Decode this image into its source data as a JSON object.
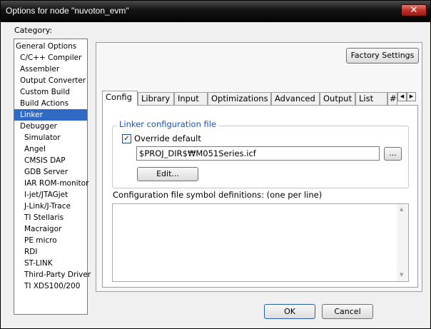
{
  "window": {
    "title": "Options for node \"nuvoton_evm\"",
    "close_symbol": "✕"
  },
  "category": {
    "label": "Category:",
    "items": [
      {
        "label": "General Options",
        "level": 0,
        "selected": false
      },
      {
        "label": "C/C++ Compiler",
        "level": 1,
        "selected": false
      },
      {
        "label": "Assembler",
        "level": 1,
        "selected": false
      },
      {
        "label": "Output Converter",
        "level": 1,
        "selected": false
      },
      {
        "label": "Custom Build",
        "level": 1,
        "selected": false
      },
      {
        "label": "Build Actions",
        "level": 1,
        "selected": false
      },
      {
        "label": "Linker",
        "level": 1,
        "selected": true
      },
      {
        "label": "Debugger",
        "level": 1,
        "selected": false
      },
      {
        "label": "Simulator",
        "level": 2,
        "selected": false
      },
      {
        "label": "Angel",
        "level": 2,
        "selected": false
      },
      {
        "label": "CMSIS DAP",
        "level": 2,
        "selected": false
      },
      {
        "label": "GDB Server",
        "level": 2,
        "selected": false
      },
      {
        "label": "IAR ROM-monitor",
        "level": 2,
        "selected": false
      },
      {
        "label": "I-jet/JTAGjet",
        "level": 2,
        "selected": false
      },
      {
        "label": "J-Link/J-Trace",
        "level": 2,
        "selected": false
      },
      {
        "label": "TI Stellaris",
        "level": 2,
        "selected": false
      },
      {
        "label": "Macraigor",
        "level": 2,
        "selected": false
      },
      {
        "label": "PE micro",
        "level": 2,
        "selected": false
      },
      {
        "label": "RDI",
        "level": 2,
        "selected": false
      },
      {
        "label": "ST-LINK",
        "level": 2,
        "selected": false
      },
      {
        "label": "Third-Party Driver",
        "level": 2,
        "selected": false
      },
      {
        "label": "TI XDS100/200",
        "level": 2,
        "selected": false
      }
    ]
  },
  "factory_settings_label": "Factory Settings",
  "tabs": [
    {
      "label": "Config",
      "active": true
    },
    {
      "label": "Library",
      "active": false
    },
    {
      "label": "Input",
      "active": false
    },
    {
      "label": "Optimizations",
      "active": false
    },
    {
      "label": "Advanced",
      "active": false
    },
    {
      "label": "Output",
      "active": false
    },
    {
      "label": "List",
      "active": false
    },
    {
      "label": "#",
      "active": false
    }
  ],
  "tab_scroll": {
    "left_symbol": "◀",
    "right_symbol": "▶"
  },
  "linker_config": {
    "group_title": "Linker configuration file",
    "override_label": "Override default",
    "override_checked": true,
    "check_symbol": "✓",
    "file_path": "$PROJ_DIR$₩M051Series.icf",
    "browse_label": "...",
    "edit_label": "Edit..."
  },
  "symbol_defs": {
    "label": "Configuration file symbol definitions: (one per line)",
    "value": "",
    "scroll_up": "▲",
    "scroll_down": "▼"
  },
  "footer": {
    "ok_label": "OK",
    "cancel_label": "Cancel"
  },
  "colors": {
    "selection": "#316ac5",
    "group_title": "#1e50b4"
  }
}
